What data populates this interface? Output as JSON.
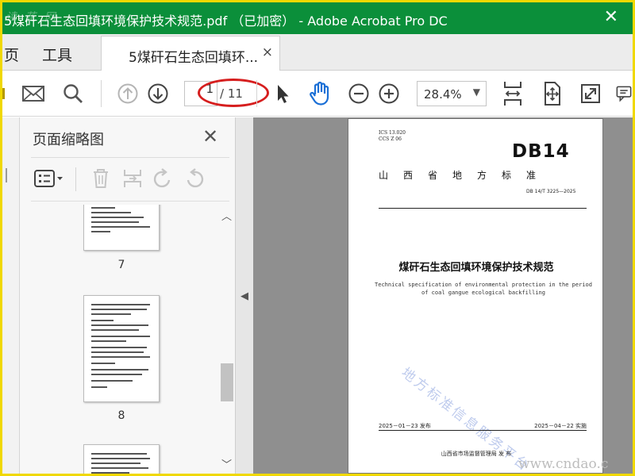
{
  "titlebar": {
    "title": "5煤矸石生态回填环境保护技术规范.pdf （已加密） - Adobe Acrobat Pro DC",
    "corner_watermark": "读 花 网"
  },
  "tabs": {
    "home": "页",
    "tools": "工具",
    "document": "5煤矸石生态回填环...",
    "close_glyph": "×"
  },
  "toolbar": {
    "page_current": "1",
    "page_total": "/ 11",
    "zoom": "28.4%",
    "zoom_arrow": "▼"
  },
  "thumbnails_panel": {
    "title": "页面缩略图",
    "close_glyph": "✕",
    "pages": [
      {
        "label": "7"
      },
      {
        "label": "8"
      }
    ]
  },
  "document_page": {
    "ics": "ICS  13.020",
    "ccs": "CCS  Z 06",
    "db": "DB14",
    "province": "山西省地方标准",
    "standard_no": "DB 14/T  3225—2025",
    "title_cn": "煤矸石生态回填环境保护技术规范",
    "title_en": "Technical specification of environmental protection in the period of coal gangue ecological backfilling",
    "stamp": "地方标准信息服务平台",
    "publish_date": "2025－01－23 发布",
    "implement_date": "2025－04－22 实施",
    "issuer": "山西省市场监督管理局    发  布"
  },
  "watermark": "www.cndao.c",
  "colors": {
    "titlebar": "#0b8f3a",
    "border": "#f0d800",
    "annotation": "#d61e1e",
    "hand_tool": "#1a6fd6",
    "doc_background": "#8f8f8f"
  }
}
